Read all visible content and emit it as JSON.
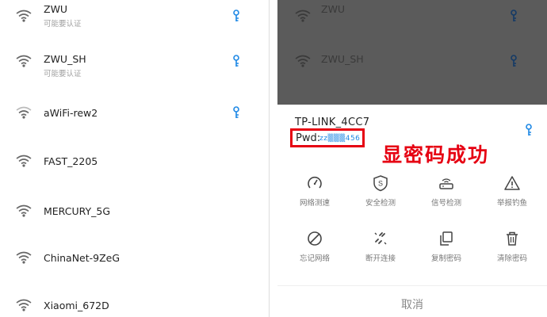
{
  "networks": [
    {
      "name": "ZWU",
      "subtitle": "可能要认证",
      "has_key": true
    },
    {
      "name": "ZWU_SH",
      "subtitle": "可能要认证",
      "has_key": true
    },
    {
      "name": "aWiFi-rew2",
      "subtitle": "",
      "has_key": true
    },
    {
      "name": "FAST_2205",
      "subtitle": "",
      "has_key": false
    },
    {
      "name": "MERCURY_5G",
      "subtitle": "",
      "has_key": false
    },
    {
      "name": "ChinaNet-9ZeG",
      "subtitle": "",
      "has_key": false
    },
    {
      "name": "Xiaomi_672D",
      "subtitle": "",
      "has_key": false
    }
  ],
  "background_networks": [
    {
      "name": "ZWU",
      "has_key": true
    },
    {
      "name": "ZWU_SH",
      "has_key": true
    }
  ],
  "sheet": {
    "ssid": "TP-LINK_4CC7",
    "pwd_label": "Pwd:",
    "pwd_value": "zz▒▒▒456",
    "success_text": "显密码成功",
    "actions": [
      {
        "label": "网络测速",
        "icon": "speed-gauge-icon"
      },
      {
        "label": "安全检测",
        "icon": "shield-s-icon"
      },
      {
        "label": "信号检测",
        "icon": "router-signal-icon"
      },
      {
        "label": "举报钓鱼",
        "icon": "warning-triangle-icon"
      },
      {
        "label": "忘记网络",
        "icon": "forbidden-icon"
      },
      {
        "label": "断开连接",
        "icon": "broken-link-icon"
      },
      {
        "label": "复制密码",
        "icon": "copy-icon"
      },
      {
        "label": "清除密码",
        "icon": "trash-icon"
      }
    ],
    "cancel_label": "取消"
  },
  "colors": {
    "accent_blue": "#1e88e5",
    "highlight_red": "#e60012",
    "overlay_gray": "#5b5b5b"
  }
}
